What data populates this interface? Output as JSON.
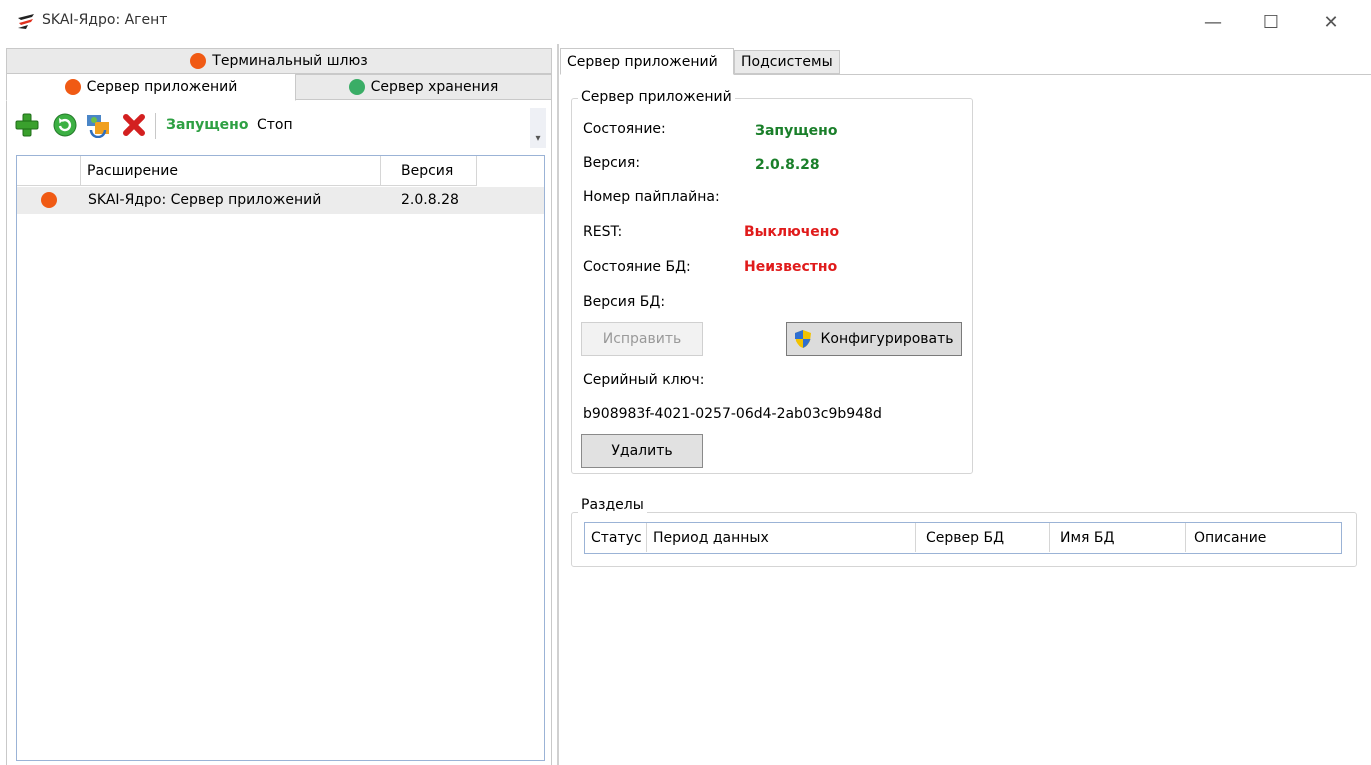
{
  "window": {
    "title": "SKAI-Ядро: Агент",
    "controls": {
      "minimize": "—",
      "maximize": "☐",
      "close": "✕"
    }
  },
  "left_tabs": {
    "terminal": {
      "label": "Терминальный шлюз",
      "status_color": "#f05a14"
    },
    "appserver": {
      "label": "Сервер приложений",
      "status_color": "#f05a14"
    },
    "storage": {
      "label": "Сервер хранения",
      "status_color": "#3aad66"
    }
  },
  "toolbar": {
    "icons": [
      "add-icon",
      "refresh-icon",
      "update-icon",
      "delete-icon"
    ],
    "status": "Запущено",
    "stop": "Стоп",
    "overflow": "▾"
  },
  "extensions_grid": {
    "columns": [
      "",
      "Расширение",
      "Версия"
    ],
    "rows": [
      {
        "status_color": "#f05a14",
        "extension": "SKAI-Ядро: Сервер приложений",
        "version": "2.0.8.28"
      }
    ]
  },
  "right_tabs": {
    "appserver": "Сервер приложений",
    "subsystems": "Подсистемы"
  },
  "server_group": {
    "title": "Сервер приложений",
    "state_label": "Состояние:",
    "state_value": "Запущено",
    "version_label": "Версия:",
    "version_value": "2.0.8.28",
    "pipeline_label": "Номер пайплайна:",
    "rest_label": "REST:",
    "rest_value": "Выключено",
    "db_state_label": "Состояние БД:",
    "db_state_value": "Неизвестно",
    "db_version_label": "Версия БД:",
    "fix_button": "Исправить",
    "configure_button": "Конфигурировать",
    "serial_label": "Серийный ключ:",
    "serial_value": "b908983f-4021-0257-06d4-2ab03c9b948d",
    "delete_button": "Удалить"
  },
  "sections_group": {
    "title": "Разделы",
    "columns": [
      "Статус",
      "Период данных",
      "Сервер БД",
      "Имя БД",
      "Описание"
    ]
  }
}
